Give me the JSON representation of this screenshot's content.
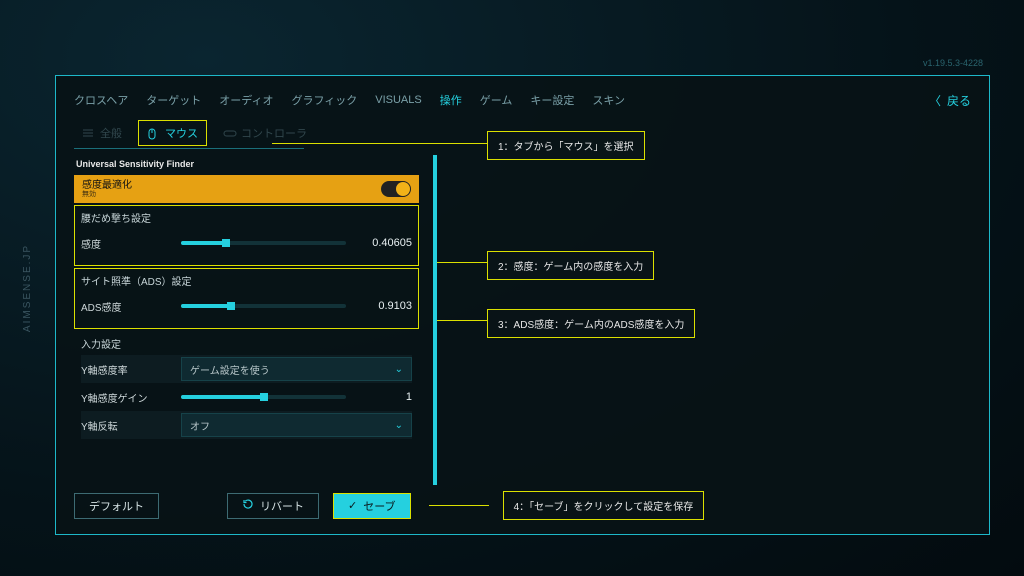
{
  "watermark": "AIMSENSE.JP",
  "version": "v1.19.5.3-4228",
  "back_label": "戻る",
  "topnav": {
    "items": [
      "クロスヘア",
      "ターゲット",
      "オーディオ",
      "グラフィック",
      "VISUALS",
      "操作",
      "ゲーム",
      "キー設定",
      "スキン"
    ],
    "active_index": 5
  },
  "subtabs": {
    "general": "全般",
    "mouse": "マウス",
    "controller": "コントローラ"
  },
  "usf_title": "Universal Sensitivity Finder",
  "optimize": {
    "label": "感度最適化",
    "sub": "無効"
  },
  "hipfire": {
    "group_title": "腰だめ撃ち設定",
    "row_label": "感度",
    "value": "0.40605",
    "fill_pct": 27
  },
  "ads": {
    "group_title": "サイト照準（ADS）設定",
    "row_label": "ADS感度",
    "value": "0.9103",
    "fill_pct": 30
  },
  "input": {
    "group_title": "入力設定",
    "y_ratio_label": "Y軸感度率",
    "y_ratio_value": "ゲーム設定を使う",
    "y_gain_label": "Y軸感度ゲイン",
    "y_gain_value": "1",
    "y_gain_fill_pct": 50,
    "y_invert_label": "Y軸反転",
    "y_invert_value": "オフ"
  },
  "buttons": {
    "default": "デフォルト",
    "revert": "リバート",
    "save": "セーブ"
  },
  "callouts": {
    "c1": "1：タブから「マウス」を選択",
    "c2": "2：感度：ゲーム内の感度を入力",
    "c3": "3：ADS感度：ゲーム内のADS感度を入力",
    "c4": "4：「セーブ」をクリックして設定を保存"
  }
}
